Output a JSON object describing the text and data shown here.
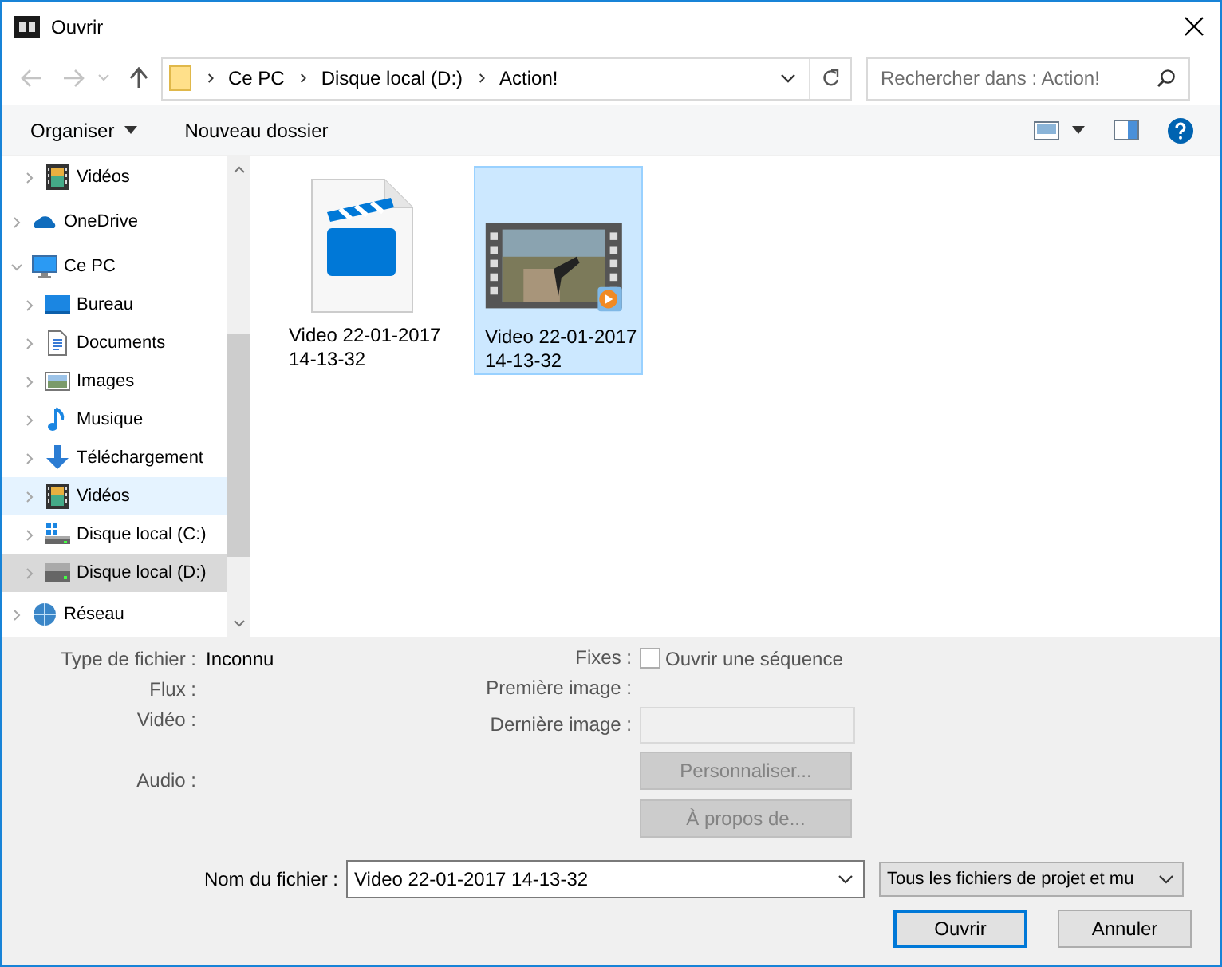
{
  "window": {
    "title": "Ouvrir"
  },
  "address_bar": {
    "segments": [
      "Ce PC",
      "Disque local (D:)",
      "Action!"
    ]
  },
  "search": {
    "placeholder": "Rechercher dans : Action!"
  },
  "toolbar": {
    "organize": "Organiser",
    "new_folder": "Nouveau dossier"
  },
  "sidebar": {
    "scrolled_children": [
      {
        "label": "Vidéos",
        "kind": "video",
        "selected": false,
        "hovered": false,
        "expanded": false
      }
    ],
    "items": [
      {
        "label": "OneDrive",
        "kind": "cloud",
        "selected": false,
        "hovered": false,
        "expanded": false
      },
      {
        "label": "Ce PC",
        "kind": "pc",
        "selected": false,
        "hovered": false,
        "expanded": true,
        "children": [
          {
            "label": "Bureau",
            "kind": "desktop",
            "selected": false,
            "hovered": false,
            "expanded": false
          },
          {
            "label": "Documents",
            "kind": "documents",
            "selected": false,
            "hovered": false,
            "expanded": false
          },
          {
            "label": "Images",
            "kind": "images",
            "selected": false,
            "hovered": false,
            "expanded": false
          },
          {
            "label": "Musique",
            "kind": "music",
            "selected": false,
            "hovered": false,
            "expanded": false
          },
          {
            "label": "Téléchargement",
            "kind": "download",
            "selected": false,
            "hovered": false,
            "expanded": false
          },
          {
            "label": "Vidéos",
            "kind": "video",
            "selected": false,
            "hovered": true,
            "expanded": false
          },
          {
            "label": "Disque local (C:)",
            "kind": "drive-c",
            "selected": false,
            "hovered": false,
            "expanded": false
          },
          {
            "label": "Disque local (D:)",
            "kind": "drive-d",
            "selected": true,
            "hovered": false,
            "expanded": false
          }
        ]
      },
      {
        "label": "Réseau",
        "kind": "network",
        "selected": false,
        "hovered": false,
        "expanded": false
      }
    ]
  },
  "files": [
    {
      "name": "Video 22-01-2017\n14-13-32",
      "kind": "project",
      "selected": false
    },
    {
      "name": "Video 22-01-2017\n14-13-32",
      "kind": "video",
      "selected": true
    }
  ],
  "info": {
    "left": [
      {
        "label": "Type de fichier :",
        "value": "Inconnu"
      },
      {
        "label": "Flux :"
      },
      {
        "label": "Vidéo :"
      },
      {
        "label": "Audio :"
      }
    ],
    "fixes_label": "Fixes :",
    "sequence": {
      "label": "Ouvrir une séquence",
      "checked": false
    },
    "first_image_label": "Première image :",
    "last_image_label": "Dernière image :",
    "buttons": [
      {
        "label": "Personnaliser...",
        "disabled": true
      },
      {
        "label": "À propos de...",
        "disabled": true
      }
    ]
  },
  "filename": {
    "label": "Nom du fichier :",
    "value": "Video 22-01-2017 14-13-32"
  },
  "filter": {
    "value": "Tous les fichiers de projet et mu"
  },
  "buttons": [
    {
      "label": "Ouvrir",
      "default": true
    },
    {
      "label": "Annuler",
      "default": false
    }
  ]
}
